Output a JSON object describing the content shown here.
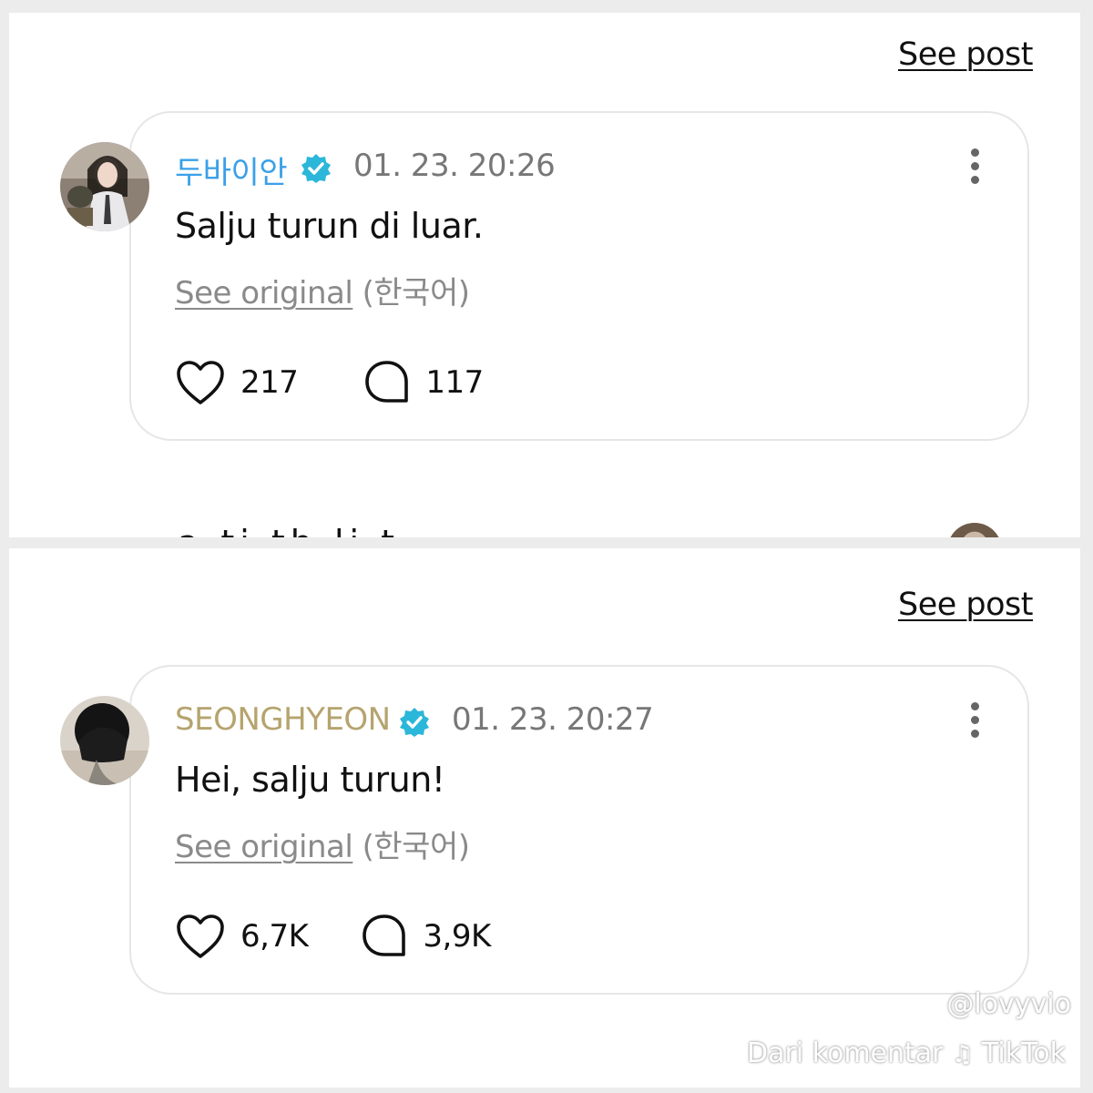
{
  "posts": [
    {
      "see_post_label": "See post",
      "username": "두바이안",
      "username_color": "#3aa0e8",
      "verified_icon": "verified-badge-icon",
      "timestamp": "01. 23. 20:26",
      "message": "Salju turun di luar.",
      "see_original_label": "See original",
      "original_language": "(한국어)",
      "likes": "217",
      "comments": "117"
    },
    {
      "see_post_label": "See post",
      "username": "SEONGHYEON",
      "username_color": "#b5a46e",
      "verified_icon": "verified-badge-icon",
      "timestamp": "01. 23. 20:27",
      "message": "Hei, salju turun!",
      "see_original_label": "See original",
      "original_language": "(한국어)",
      "likes": "6,7K",
      "comments": "3,9K"
    }
  ],
  "partial_next_post_text": "a ti th   li  t",
  "watermark": {
    "handle": "@lovyvio",
    "source": "Dari komentar",
    "platform": "TikTok"
  },
  "colors": {
    "verified_badge": "#2bb7d9",
    "card_border": "#e6e6e6",
    "muted_text": "#8a8a8a"
  }
}
